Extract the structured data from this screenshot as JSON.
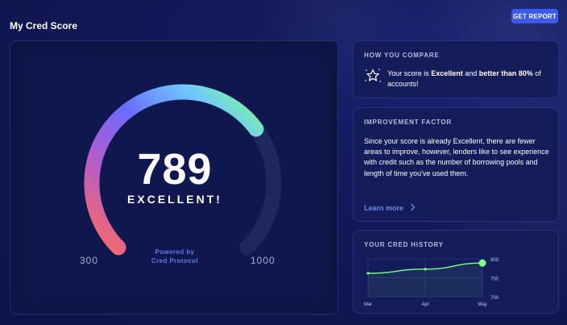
{
  "page": {
    "title": "My Cred Score",
    "get_report_label": "GET REPORT"
  },
  "score_card": {
    "score": "789",
    "rating": "EXCELLENT!",
    "min": "300",
    "max": "1000",
    "powered_by_line1": "Powered by",
    "powered_by_line2": "Cred Protocol",
    "score_value": 789,
    "score_min": 300,
    "score_max": 1000
  },
  "compare_card": {
    "heading": "HOW YOU COMPARE",
    "text_1": "Your score is ",
    "text_bold_1": "Excellent",
    "text_2": " and ",
    "text_bold_2": "better than 80%",
    "text_3": " of accounts!",
    "icon": "star-outline-icon"
  },
  "improvement_card": {
    "heading": "IMPROVEMENT FACTOR",
    "body": "Since your score is already Excellent, there are fewer areas to improve, however, lenders like to see experience with credit such as the number of borrowing pools and length of time you've used them.",
    "link_label": "Learn more",
    "link_icon": "chevron-right-icon"
  },
  "history_card": {
    "heading": "YOUR CRED HISTORY"
  },
  "chart_data": {
    "type": "line",
    "x": [
      "Mar",
      "Apr",
      "May"
    ],
    "series": [
      {
        "values": [
          762,
          773,
          789
        ]
      }
    ],
    "y_ticks": [
      "800",
      "750",
      "700"
    ],
    "ylim": [
      700,
      800
    ],
    "grid": true,
    "color": "#7dff8a"
  },
  "colors": {
    "accent": "#3b5bf0",
    "gauge_start": "#ff6b5e",
    "gauge_mid": "#6b6bff",
    "gauge_end": "#7dff8a",
    "link": "#6f86f0"
  }
}
